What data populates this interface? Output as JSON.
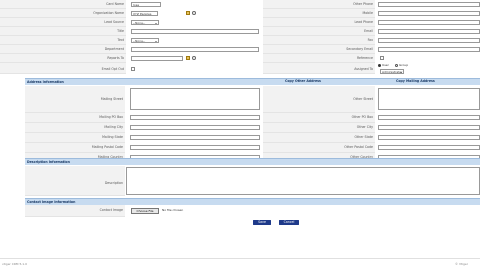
{
  "top_labels": {
    "card_name": "Card Name",
    "organization_name": "Organization Name",
    "lead_source": "Lead Source",
    "title": "Title",
    "text": "Text",
    "department": "Department",
    "reports_to": "Reports To",
    "email_opt_out": "Email Opt Out",
    "other_phone": "Other Phone",
    "mobile": "Mobile",
    "lead_phone": "Lead Phone",
    "email": "Email",
    "fax": "Fax",
    "secondary_email": "Secondary Email",
    "reference": "Reference",
    "assigned_to": "Assigned To"
  },
  "values": {
    "card_name": "Jose",
    "organization_name": "XYZ Peoples",
    "lead_source": "--None--",
    "text": "--None--"
  },
  "assigned": {
    "user_option": "User",
    "group_option": "Group",
    "user_value": "Administrator"
  },
  "address": {
    "section_title": "Address Information",
    "copy_other": "Copy Other Address",
    "copy_mailing": "Copy Mailing Address",
    "left_labels": [
      "Mailing Street",
      "Mailing PO Box",
      "Mailing City",
      "Mailing State",
      "Mailing Postal Code",
      "Mailing Country"
    ],
    "right_labels": [
      "Other Street",
      "Other PO Box",
      "Other City",
      "Other State",
      "Other Postal Code",
      "Other Country"
    ]
  },
  "description": {
    "section_title": "Description Information",
    "label": "Description"
  },
  "image": {
    "section_title": "Contact Image Information",
    "label": "Contact Image",
    "choose_file": "Choose File",
    "no_file": "No file chosen"
  },
  "buttons": {
    "save": "Save",
    "cancel": "Cancel"
  },
  "footer": {
    "left": "vtiger CRM 5.1.0",
    "right": "© Vtiger"
  }
}
